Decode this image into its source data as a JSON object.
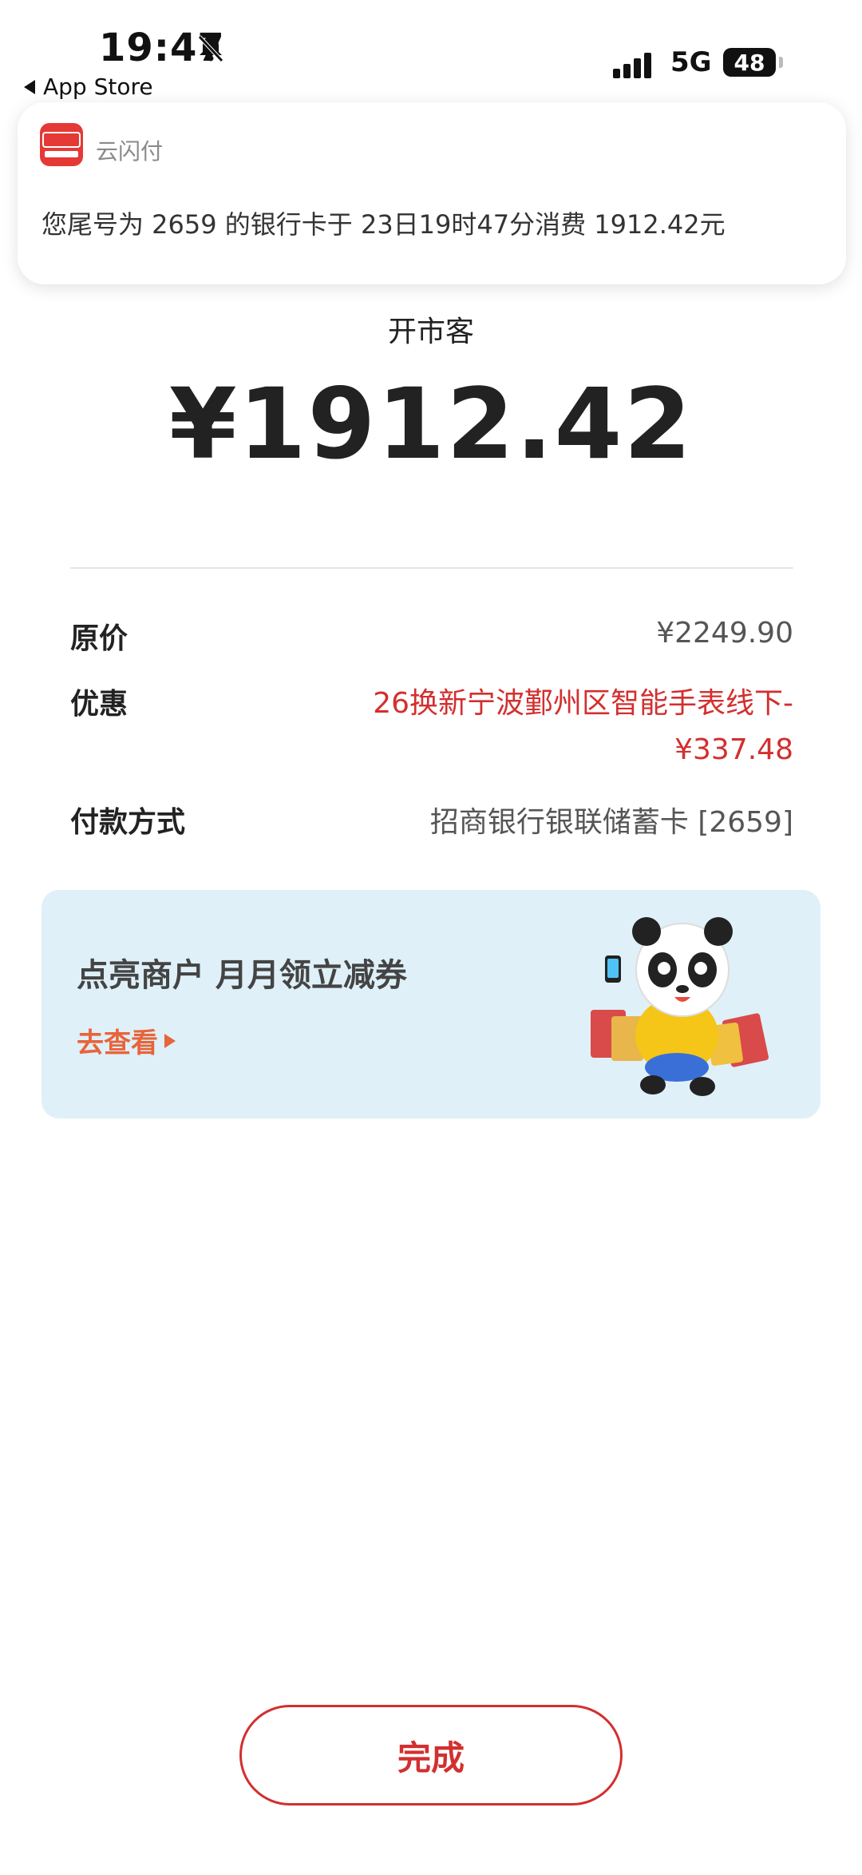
{
  "status_bar": {
    "time": "19:47",
    "back_label": "App Store",
    "network": "5G",
    "battery": "48"
  },
  "notification": {
    "app_name": "云闪付",
    "message": "您尾号为 2659 的银行卡于 23日19时47分消费 1912.42元"
  },
  "payment": {
    "merchant": "开市客",
    "amount": "¥1912.42",
    "rows": {
      "original_price_label": "原价",
      "original_price_value": "¥2249.90",
      "discount_label": "优惠",
      "discount_value": "26换新宁波鄞州区智能手表线下-¥337.48",
      "method_label": "付款方式",
      "method_value": "招商银行银联储蓄卡 [2659]"
    }
  },
  "banner": {
    "title": "点亮商户 月月领立减券",
    "link_label": "去查看"
  },
  "done_button": {
    "label": "完成"
  },
  "colors": {
    "accent_red": "#d32f2f",
    "banner_bg": "#dff0f8",
    "link_orange": "#e8643a"
  }
}
